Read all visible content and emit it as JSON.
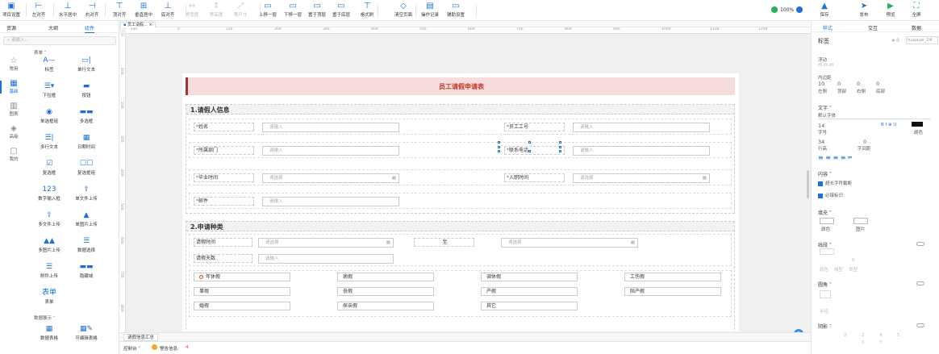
{
  "toolbar": {
    "items": [
      {
        "label": "项目设置",
        "icon": "project-settings-icon",
        "enabled": true
      },
      {
        "label": "左对齐",
        "icon": "align-left-icon",
        "enabled": true
      },
      {
        "label": "水平居中",
        "icon": "align-center-h-icon",
        "enabled": true
      },
      {
        "label": "右对齐",
        "icon": "align-right-icon",
        "enabled": true
      },
      {
        "label": "顶对齐",
        "icon": "align-top-icon",
        "enabled": true
      },
      {
        "label": "垂直居中",
        "icon": "align-center-v-icon",
        "enabled": true
      },
      {
        "label": "底对齐",
        "icon": "align-bottom-icon",
        "enabled": true
      },
      {
        "label": "等宽度",
        "icon": "equal-width-icon",
        "enabled": false
      },
      {
        "label": "等高度",
        "icon": "equal-height-icon",
        "enabled": false
      },
      {
        "label": "等尺寸",
        "icon": "equal-size-icon",
        "enabled": false
      },
      {
        "label": "上移一层",
        "icon": "move-up-icon",
        "enabled": true
      },
      {
        "label": "下移一层",
        "icon": "move-down-icon",
        "enabled": true
      },
      {
        "label": "置于顶层",
        "icon": "bring-to-front-icon",
        "enabled": true
      },
      {
        "label": "置于底层",
        "icon": "send-to-back-icon",
        "enabled": true
      },
      {
        "label": "格式刷",
        "icon": "format-painter-icon",
        "enabled": true
      },
      {
        "label": "清空页面",
        "icon": "clear-page-icon",
        "enabled": true
      },
      {
        "label": "操作记录",
        "icon": "history-icon",
        "enabled": true
      },
      {
        "label": "辅助设置",
        "icon": "aux-settings-icon",
        "enabled": true
      }
    ],
    "zoom": "100%",
    "actions": [
      {
        "label": "保存",
        "icon": "save-icon"
      },
      {
        "label": "发布",
        "icon": "publish-icon"
      },
      {
        "label": "预览",
        "icon": "preview-icon"
      },
      {
        "label": "全屏",
        "icon": "fullscreen-icon"
      }
    ]
  },
  "left": {
    "tabs": [
      "资源",
      "大纲",
      "组件"
    ],
    "active_tab": "组件",
    "search_placeholder": "请输入...",
    "nav": [
      {
        "label": "常用",
        "icon": "star-icon"
      },
      {
        "label": "基础",
        "icon": "grid-icon"
      },
      {
        "label": "图表",
        "icon": "chart-icon"
      },
      {
        "label": "高级",
        "icon": "diamond-icon"
      },
      {
        "label": "我的",
        "icon": "cube-icon"
      }
    ],
    "group_form": "表单 ˅",
    "components": [
      {
        "label": "标签",
        "icon": "A—"
      },
      {
        "label": "单行文本",
        "icon": "▭|"
      },
      {
        "label": "下拉框",
        "icon": "☰▾"
      },
      {
        "label": "按钮",
        "icon": "▬"
      },
      {
        "label": "单选框组",
        "icon": "◉"
      },
      {
        "label": "多选框",
        "icon": "▬▬"
      },
      {
        "label": "多行文本",
        "icon": "☰|"
      },
      {
        "label": "日期时间",
        "icon": "▦"
      },
      {
        "label": "复选框",
        "icon": "☑"
      },
      {
        "label": "复选框组",
        "icon": "☐☐"
      },
      {
        "label": "数字输入框",
        "icon": "123"
      },
      {
        "label": "单文件上传",
        "icon": "⇪"
      },
      {
        "label": "多文件上传",
        "icon": "⇪"
      },
      {
        "label": "单图片上传",
        "icon": "▲"
      },
      {
        "label": "多图片上传",
        "icon": "▲▲"
      },
      {
        "label": "数据选择",
        "icon": "☰"
      },
      {
        "label": "附件上传",
        "icon": "☰"
      },
      {
        "label": "隐藏域",
        "icon": "▬▬"
      },
      {
        "label": "表单",
        "icon": "表单"
      }
    ],
    "group_data": "数据展示 ˅",
    "data_components": [
      {
        "label": "数据表格",
        "icon": "▦"
      },
      {
        "label": "可编辑表格",
        "icon": "▦✎"
      }
    ]
  },
  "canvas": {
    "doc_tab": "员工请假...",
    "ruler_ticks": [
      "-100",
      "0",
      "100",
      "200",
      "300",
      "400",
      "500",
      "600",
      "700",
      "800",
      "900",
      "1000",
      "1100",
      "1200"
    ],
    "vruler_ticks": [
      "0",
      "100",
      "200",
      "300",
      "400",
      "500",
      "600",
      "700",
      "800"
    ],
    "form_title": "员工请假申请表",
    "section1": {
      "title": "1.请假人信息",
      "rows": [
        [
          {
            "label": "*姓名",
            "placeholder": "请输入"
          },
          {
            "label": "*员工工号",
            "placeholder": "请输入"
          }
        ],
        [
          {
            "label": "*所属部门",
            "placeholder": "请输入"
          },
          {
            "label": "*联系电话",
            "placeholder": "请输入"
          }
        ],
        [
          {
            "label": "*毕业时间",
            "placeholder": "请选择"
          },
          {
            "label": "*入职时间",
            "placeholder": "请选择"
          }
        ],
        [
          {
            "label": "*邮件",
            "placeholder": "请输入"
          }
        ]
      ]
    },
    "section2": {
      "title": "2.申请种类",
      "time_label": "请假时间",
      "time_from": "请选择",
      "to_label": "至",
      "time_to": "请选择",
      "days_label": "请假天数",
      "days_placeholder": "请输入",
      "leave_types": [
        [
          "年休假",
          "病假",
          "调休假",
          "工伤假"
        ],
        [
          "事假",
          "丧假",
          "产假",
          "陪产假"
        ],
        [
          "婚假",
          "探亲假",
          "其它"
        ]
      ],
      "selected": "年休假"
    },
    "bottom_tab": "请假信息汇总",
    "console_label": "控制台 ˅",
    "warning_label": "警告信息:",
    "warning_count": "4",
    "help": "?"
  },
  "right": {
    "tabs": [
      "样式",
      "交互",
      "数据"
    ],
    "active_tab": "样式",
    "element_type": "标签",
    "element_id": "huaxue_24",
    "float_label": "浮动",
    "padding_label": "内边距",
    "padding_values": [
      "10",
      "0",
      "0",
      "0"
    ],
    "padding_names": [
      "左侧",
      "顶部",
      "右侧",
      "底部"
    ],
    "text_label": "文字 ˅",
    "font_default": "默认字体",
    "font_size": "14",
    "font_size_label": "字号",
    "font_styles": "B I ⊕ U",
    "color_label": "颜色",
    "line_height": "34",
    "line_height_label": "行高",
    "letter_spacing": "0",
    "letter_spacing_label": "字间距",
    "content_label": "内容 ˅",
    "opt1": "超长字符截断",
    "opt2": "必填标识",
    "fill_label": "填充 ˅",
    "fill_color": "颜色",
    "fill_image": "图片",
    "border_label": "线段 ˅",
    "border_value": "0",
    "border_sub": [
      "颜色",
      "线型",
      "类型"
    ],
    "radius_label": "圆角 ˅",
    "radius_sub": "半径",
    "shadow_label": "阴影 ˅",
    "shadow_values": [
      "0",
      "2",
      "4",
      "5"
    ],
    "shadow_sub": [
      "X",
      "Y"
    ],
    "text_color": "#111111",
    "accent": "#1e6fd9"
  }
}
